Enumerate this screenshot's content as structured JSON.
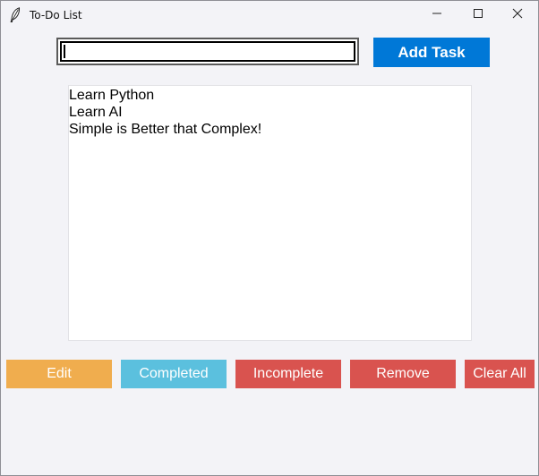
{
  "window": {
    "title": "To-Do List",
    "icon": "feather-icon",
    "controls": [
      "minimize-icon",
      "maximize-icon",
      "close-icon"
    ]
  },
  "entry": {
    "value": "",
    "placeholder": ""
  },
  "add_button": {
    "label": "Add Task",
    "color": "#0078d7"
  },
  "tasks": [
    "Learn Python",
    "Learn AI",
    "Simple is Better that Complex!"
  ],
  "actions": [
    {
      "label": "Edit",
      "color": "#f0ad4e"
    },
    {
      "label": "Completed",
      "color": "#5bc0de"
    },
    {
      "label": "Incomplete",
      "color": "#d9534f"
    },
    {
      "label": "Remove",
      "color": "#d9534f"
    },
    {
      "label": "Clear All",
      "color": "#d9534f"
    }
  ]
}
